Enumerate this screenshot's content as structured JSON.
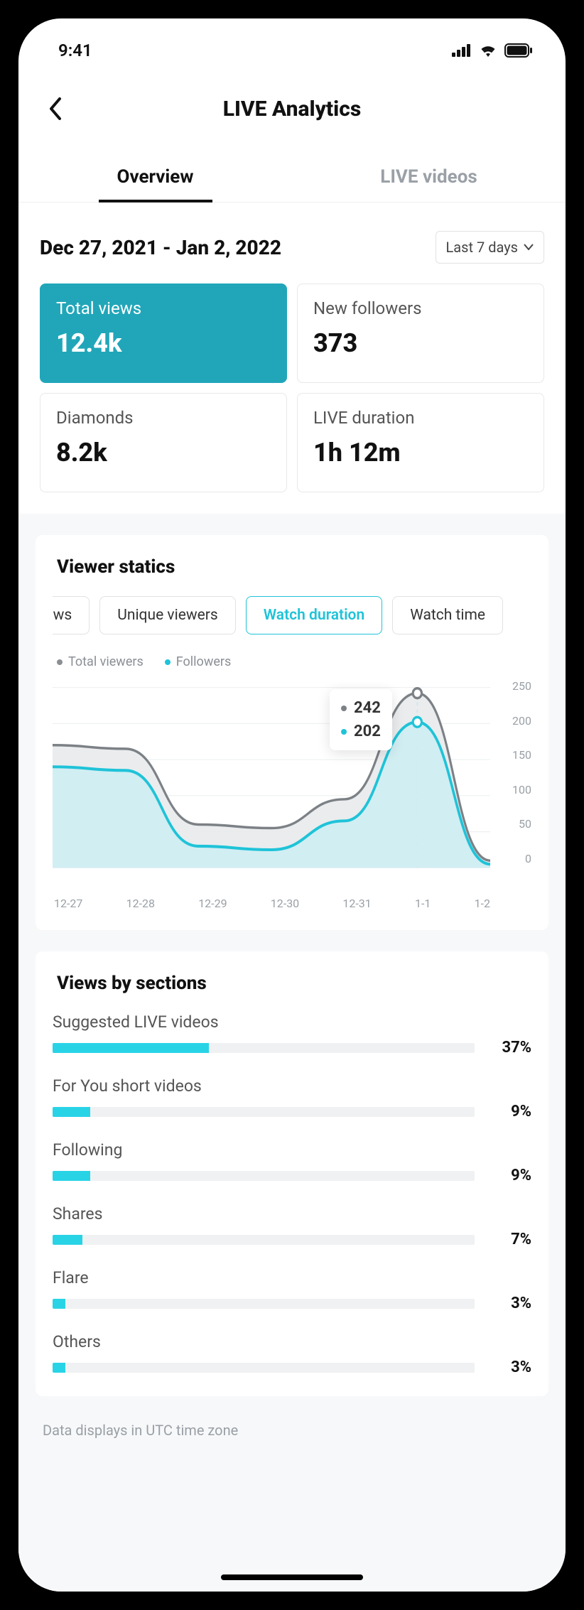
{
  "status": {
    "time": "9:41"
  },
  "header": {
    "title": "LIVE Analytics"
  },
  "tabs": {
    "items": [
      {
        "label": "Overview",
        "active": true
      },
      {
        "label": "LIVE videos",
        "active": false
      }
    ]
  },
  "date_range": {
    "text": "Dec 27, 2021 - Jan 2, 2022",
    "picker_label": "Last 7 days"
  },
  "stats": [
    {
      "label": "Total views",
      "value": "12.4k",
      "selected": true
    },
    {
      "label": "New followers",
      "value": "373",
      "selected": false
    },
    {
      "label": "Diamonds",
      "value": "8.2k",
      "selected": false
    },
    {
      "label": "LIVE duration",
      "value": "1h 12m",
      "selected": false
    }
  ],
  "viewer_stats": {
    "title": "Viewer statics",
    "chips": [
      {
        "label": "Views",
        "selected": false,
        "partial": "left"
      },
      {
        "label": "Unique viewers",
        "selected": false
      },
      {
        "label": "Watch duration",
        "selected": true
      },
      {
        "label": "Watch time",
        "selected": false,
        "partial": "right"
      }
    ],
    "legend": [
      {
        "label": "Total viewers",
        "color": "grey"
      },
      {
        "label": "Followers",
        "color": "cyan"
      }
    ],
    "tooltip": {
      "total_viewers": "242",
      "followers": "202"
    }
  },
  "chart_data": {
    "type": "line",
    "xlabel": "",
    "ylabel": "",
    "categories": [
      "12-27",
      "12-28",
      "12-29",
      "12-30",
      "12-31",
      "1-1",
      "1-2"
    ],
    "yticks": [
      0,
      50,
      100,
      150,
      200,
      250
    ],
    "ylim": [
      0,
      250
    ],
    "series": [
      {
        "name": "Total viewers",
        "color": "#7c8186",
        "values": [
          170,
          165,
          60,
          55,
          95,
          242,
          10
        ]
      },
      {
        "name": "Followers",
        "color": "#1fc3d8",
        "values": [
          140,
          135,
          30,
          25,
          65,
          202,
          5
        ]
      }
    ],
    "highlight_index": 5,
    "highlight_values": {
      "Total viewers": 242,
      "Followers": 202
    }
  },
  "views_by_sections": {
    "title": "Views by sections",
    "items": [
      {
        "label": "Suggested LIVE videos",
        "pct": 37
      },
      {
        "label": "For You short videos",
        "pct": 9
      },
      {
        "label": "Following",
        "pct": 9
      },
      {
        "label": "Shares",
        "pct": 7
      },
      {
        "label": "Flare",
        "pct": 3
      },
      {
        "label": "Others",
        "pct": 3
      }
    ]
  },
  "footnote": "Data displays in UTC time zone"
}
